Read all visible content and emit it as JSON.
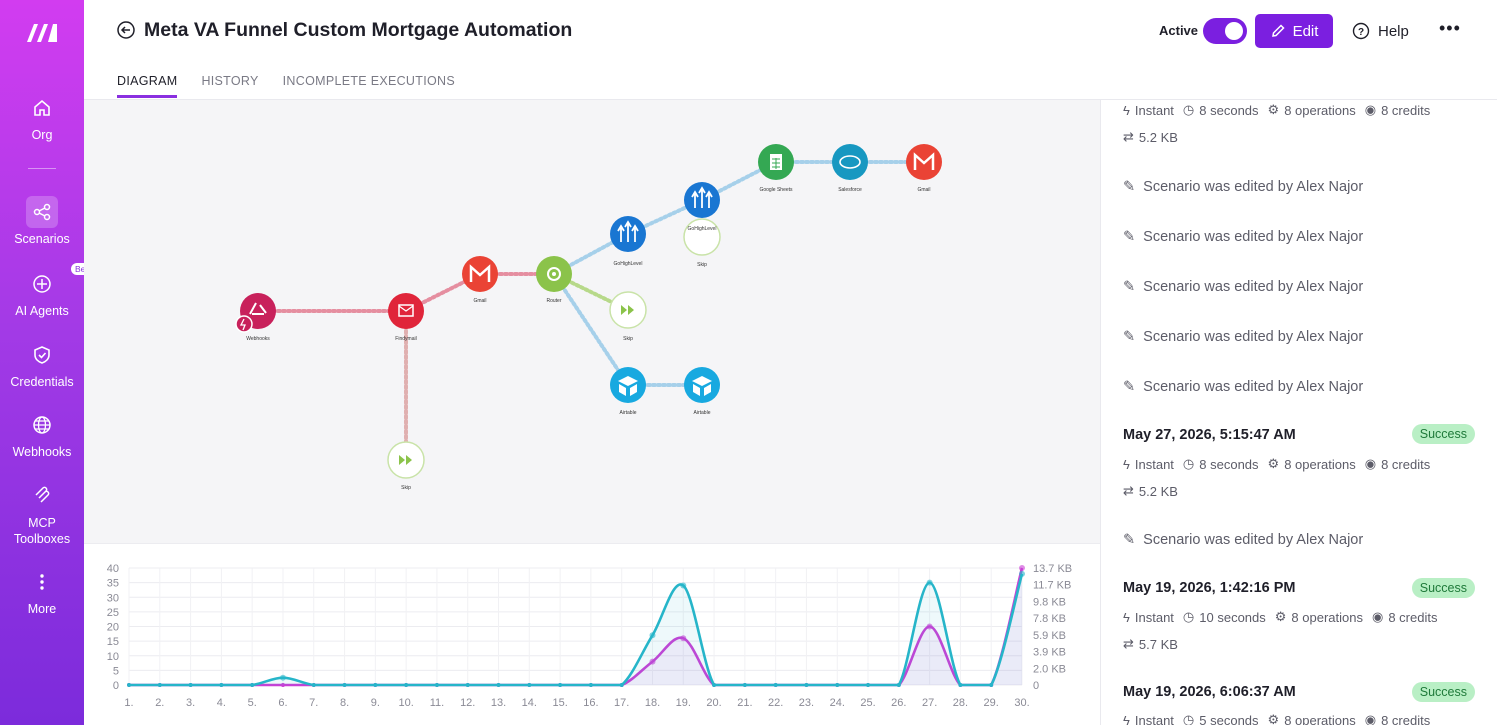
{
  "sidebar": {
    "items": [
      {
        "label": "Org",
        "icon": "home-icon"
      },
      {
        "label": "Scenarios",
        "icon": "share-icon"
      },
      {
        "label": "AI Agents",
        "icon": "sparkle-icon",
        "badge": "Beta"
      },
      {
        "label": "Credentials",
        "icon": "shield-icon"
      },
      {
        "label": "Webhooks",
        "icon": "globe-icon"
      },
      {
        "label": "MCP Toolboxes",
        "icon": "mcp-icon"
      },
      {
        "label": "More",
        "icon": "more-vertical-icon"
      }
    ]
  },
  "header": {
    "title": "Meta VA Funnel Custom Mortgage Automation",
    "tabs": [
      "DIAGRAM",
      "HISTORY",
      "INCOMPLETE EXECUTIONS"
    ],
    "active_label": "Active",
    "edit_label": "Edit",
    "help_label": "Help",
    "more": "•••"
  },
  "diagram": {
    "nodes": [
      {
        "label": "Webhooks",
        "color": "#c8215b"
      },
      {
        "label": "Findymail",
        "color": "#e0253a"
      },
      {
        "label": "Skip",
        "color": "#8bc34a"
      },
      {
        "label": "Gmail",
        "color": "#ea4335"
      },
      {
        "label": "Router",
        "color": "#8bc34a"
      },
      {
        "label": "GoHighLevel",
        "color": "#1976d2"
      },
      {
        "label": "Skip",
        "color": "#8bc34a"
      },
      {
        "label": "GoHighLevel",
        "color": "#1976d2"
      },
      {
        "label": "Skip",
        "color": "#8bc34a"
      },
      {
        "label": "Google Sheets",
        "color": "#34a853"
      },
      {
        "label": "Salesforce",
        "color": "#1798c1"
      },
      {
        "label": "Gmail",
        "color": "#ea4335"
      },
      {
        "label": "Airtable",
        "color": "#18a9e0"
      },
      {
        "label": "Airtable",
        "color": "#18a9e0"
      }
    ]
  },
  "chart_data": {
    "type": "line",
    "x": [
      "1.",
      "2.",
      "3.",
      "4.",
      "5.",
      "6.",
      "7.",
      "8.",
      "9.",
      "10.",
      "11.",
      "12.",
      "13.",
      "14.",
      "15.",
      "16.",
      "17.",
      "18.",
      "19.",
      "20.",
      "21.",
      "22.",
      "23.",
      "24.",
      "25.",
      "26.",
      "27.",
      "28.",
      "29.",
      "30."
    ],
    "series": [
      {
        "values": [
          0,
          0,
          0,
          0,
          0,
          2.5,
          0,
          0,
          0,
          0,
          0,
          0,
          0,
          0,
          0,
          0,
          0,
          17,
          34,
          0,
          0,
          0,
          0,
          0,
          0,
          0,
          35,
          0,
          0,
          38
        ],
        "color": "#26b5c9"
      },
      {
        "values": [
          0,
          0,
          0,
          0,
          0,
          0,
          0,
          0,
          0,
          0,
          0,
          0,
          0,
          0,
          0,
          0,
          0,
          8,
          16,
          0,
          0,
          0,
          0,
          0,
          0,
          0,
          20,
          0,
          0,
          40
        ],
        "color": "#c93fd6"
      }
    ],
    "y_left_ticks": [
      "0",
      "5",
      "10",
      "15",
      "20",
      "25",
      "30",
      "35",
      "40"
    ],
    "y_right_ticks": [
      "0",
      "2.0 KB",
      "3.9 KB",
      "5.9 KB",
      "7.8 KB",
      "9.8 KB",
      "11.7 KB",
      "13.7 KB"
    ],
    "ylim": [
      0,
      40
    ]
  },
  "panel": {
    "top_stats": {
      "instant": "Instant",
      "seconds": "8 seconds",
      "operations": "8 operations",
      "credits": "8 credits",
      "kb": "5.2 KB"
    },
    "edited_1": "Scenario was edited by Alex Najor",
    "edited_2": "Scenario was edited by Alex Najor",
    "edited_3": "Scenario was edited by Alex Najor",
    "edited_4": "Scenario was edited by Alex Najor",
    "edited_5": "Scenario was edited by Alex Najor",
    "run_1": {
      "date": "May 27, 2026, 5:15:47 AM",
      "status": "Success",
      "instant": "Instant",
      "seconds": "8 seconds",
      "operations": "8 operations",
      "credits": "8 credits",
      "kb": "5.2 KB"
    },
    "edited_6": "Scenario was edited by Alex Najor",
    "run_2": {
      "date": "May 19, 2026, 1:42:16 PM",
      "status": "Success",
      "instant": "Instant",
      "seconds": "10 seconds",
      "operations": "8 operations",
      "credits": "8 credits",
      "kb": "5.7 KB"
    },
    "run_3": {
      "date": "May 19, 2026, 6:06:37 AM",
      "status": "Success",
      "instant": "Instant",
      "seconds": "5 seconds",
      "operations": "8 operations",
      "credits": "8 credits"
    }
  }
}
